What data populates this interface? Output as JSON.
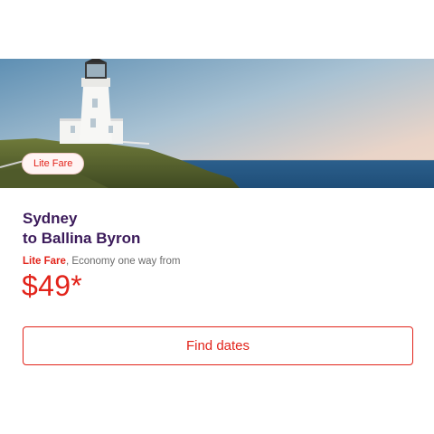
{
  "card": {
    "image_alt": "Lighthouse on a headland by the ocean",
    "badge_label": "Lite Fare",
    "route": {
      "origin": "Sydney",
      "destination": "to Ballina Byron"
    },
    "fare": {
      "type": "Lite Fare",
      "description": ", Economy one way from",
      "price": "$49*"
    },
    "cta_label": "Find dates"
  },
  "colors": {
    "accent": "#e2231a",
    "heading": "#3b1a5a",
    "muted_text": "#6b6b6b"
  }
}
